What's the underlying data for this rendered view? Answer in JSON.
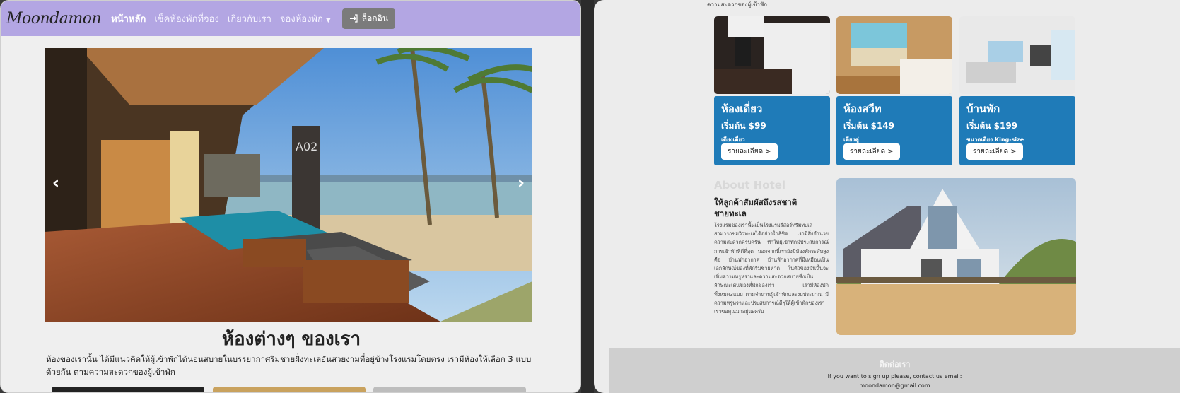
{
  "navbar": {
    "brand": "Moondamon",
    "links": [
      "หน้าหลัก",
      "เช็คห้องพักที่จอง",
      "เกี่ยวกับเรา",
      "จองห้องพัก"
    ],
    "login_label": "ล็อกอิน"
  },
  "carousel": {
    "prev": "‹",
    "next": "›",
    "sign": "A02"
  },
  "rooms_section": {
    "title": "ห้องต่างๆ ของเรา",
    "description": "ห้องของเรานั้น ได้มีแนวคิดให้ผู้เข้าพักได้นอนสบายในบรรยากาศริมชายฝั่งทะเลอันสวยงามที่อยู่ข้างโรงแรมโดยตรง เรามีห้องให้เลือก 3 แบบด้วยกัน ตามความสะดวกของผู้เข้าพัก"
  },
  "right": {
    "top_clip": "ความสะดวกของผู้เข้าพัก",
    "rooms": [
      {
        "name": "ห้องเดี่ยว",
        "price": "เริ่มต้น $99",
        "note": "เตียงเดี่ยว",
        "button": "รายละเอียด >"
      },
      {
        "name": "ห้องสวีท",
        "price": "เริ่มต้น $149",
        "note": "เตียงคู่",
        "button": "รายละเอียด >"
      },
      {
        "name": "บ้านพัก",
        "price": "เริ่มต้น $199",
        "note": "ขนาดเตียง King-size",
        "button": "รายละเอียด >"
      }
    ],
    "about": {
      "title": "About Hotel",
      "subtitle": "ให้ลูกค้าสัมผัสถึงรสชาติชายทะเล",
      "body": "โรงแรมของเรานั้นเป็นโรงแรมรีสอร์ทริมทะเล สามารถชมวิวทะเลได้อย่างใกล้ชิด เรามีสิ่งอำนวยความสะดวกครบครัน ทำให้ผู้เข้าพักมีประสบการณ์การเข้าพักที่ดีที่สุด นอกจากนี้เรายังมีห้องพักระดับสูงคือ บ้านพักอากาศ บ้านพักอากาศที่มีเหมือนเป็นเอกลักษณ์ของที่พักริมชายหาด ในตัวของมันนั้นจะเพิ่มความหรูหราและความสะดวกสบายซึ่งเป็นลักษณะเด่นของที่พักของเรา เรามีห้องพักทั้งหมด3แบบ ตามจำนวนผู้เข้าพักและงบประมาณ มีความหรูหราและประสบการณ์ดีๆให้ผู้เข้าพักของเรา เราขอคุณมาอยู่นะครับ"
    },
    "footer": {
      "title": "ติดต่อเรา",
      "line1": "If you want to sign up please, contact us email:",
      "email": "moondamon@gmail.com"
    }
  },
  "colors": {
    "navbar": "#b3a6e3",
    "card_blue": "#1f7bb8",
    "login": "#7b7b7b"
  }
}
